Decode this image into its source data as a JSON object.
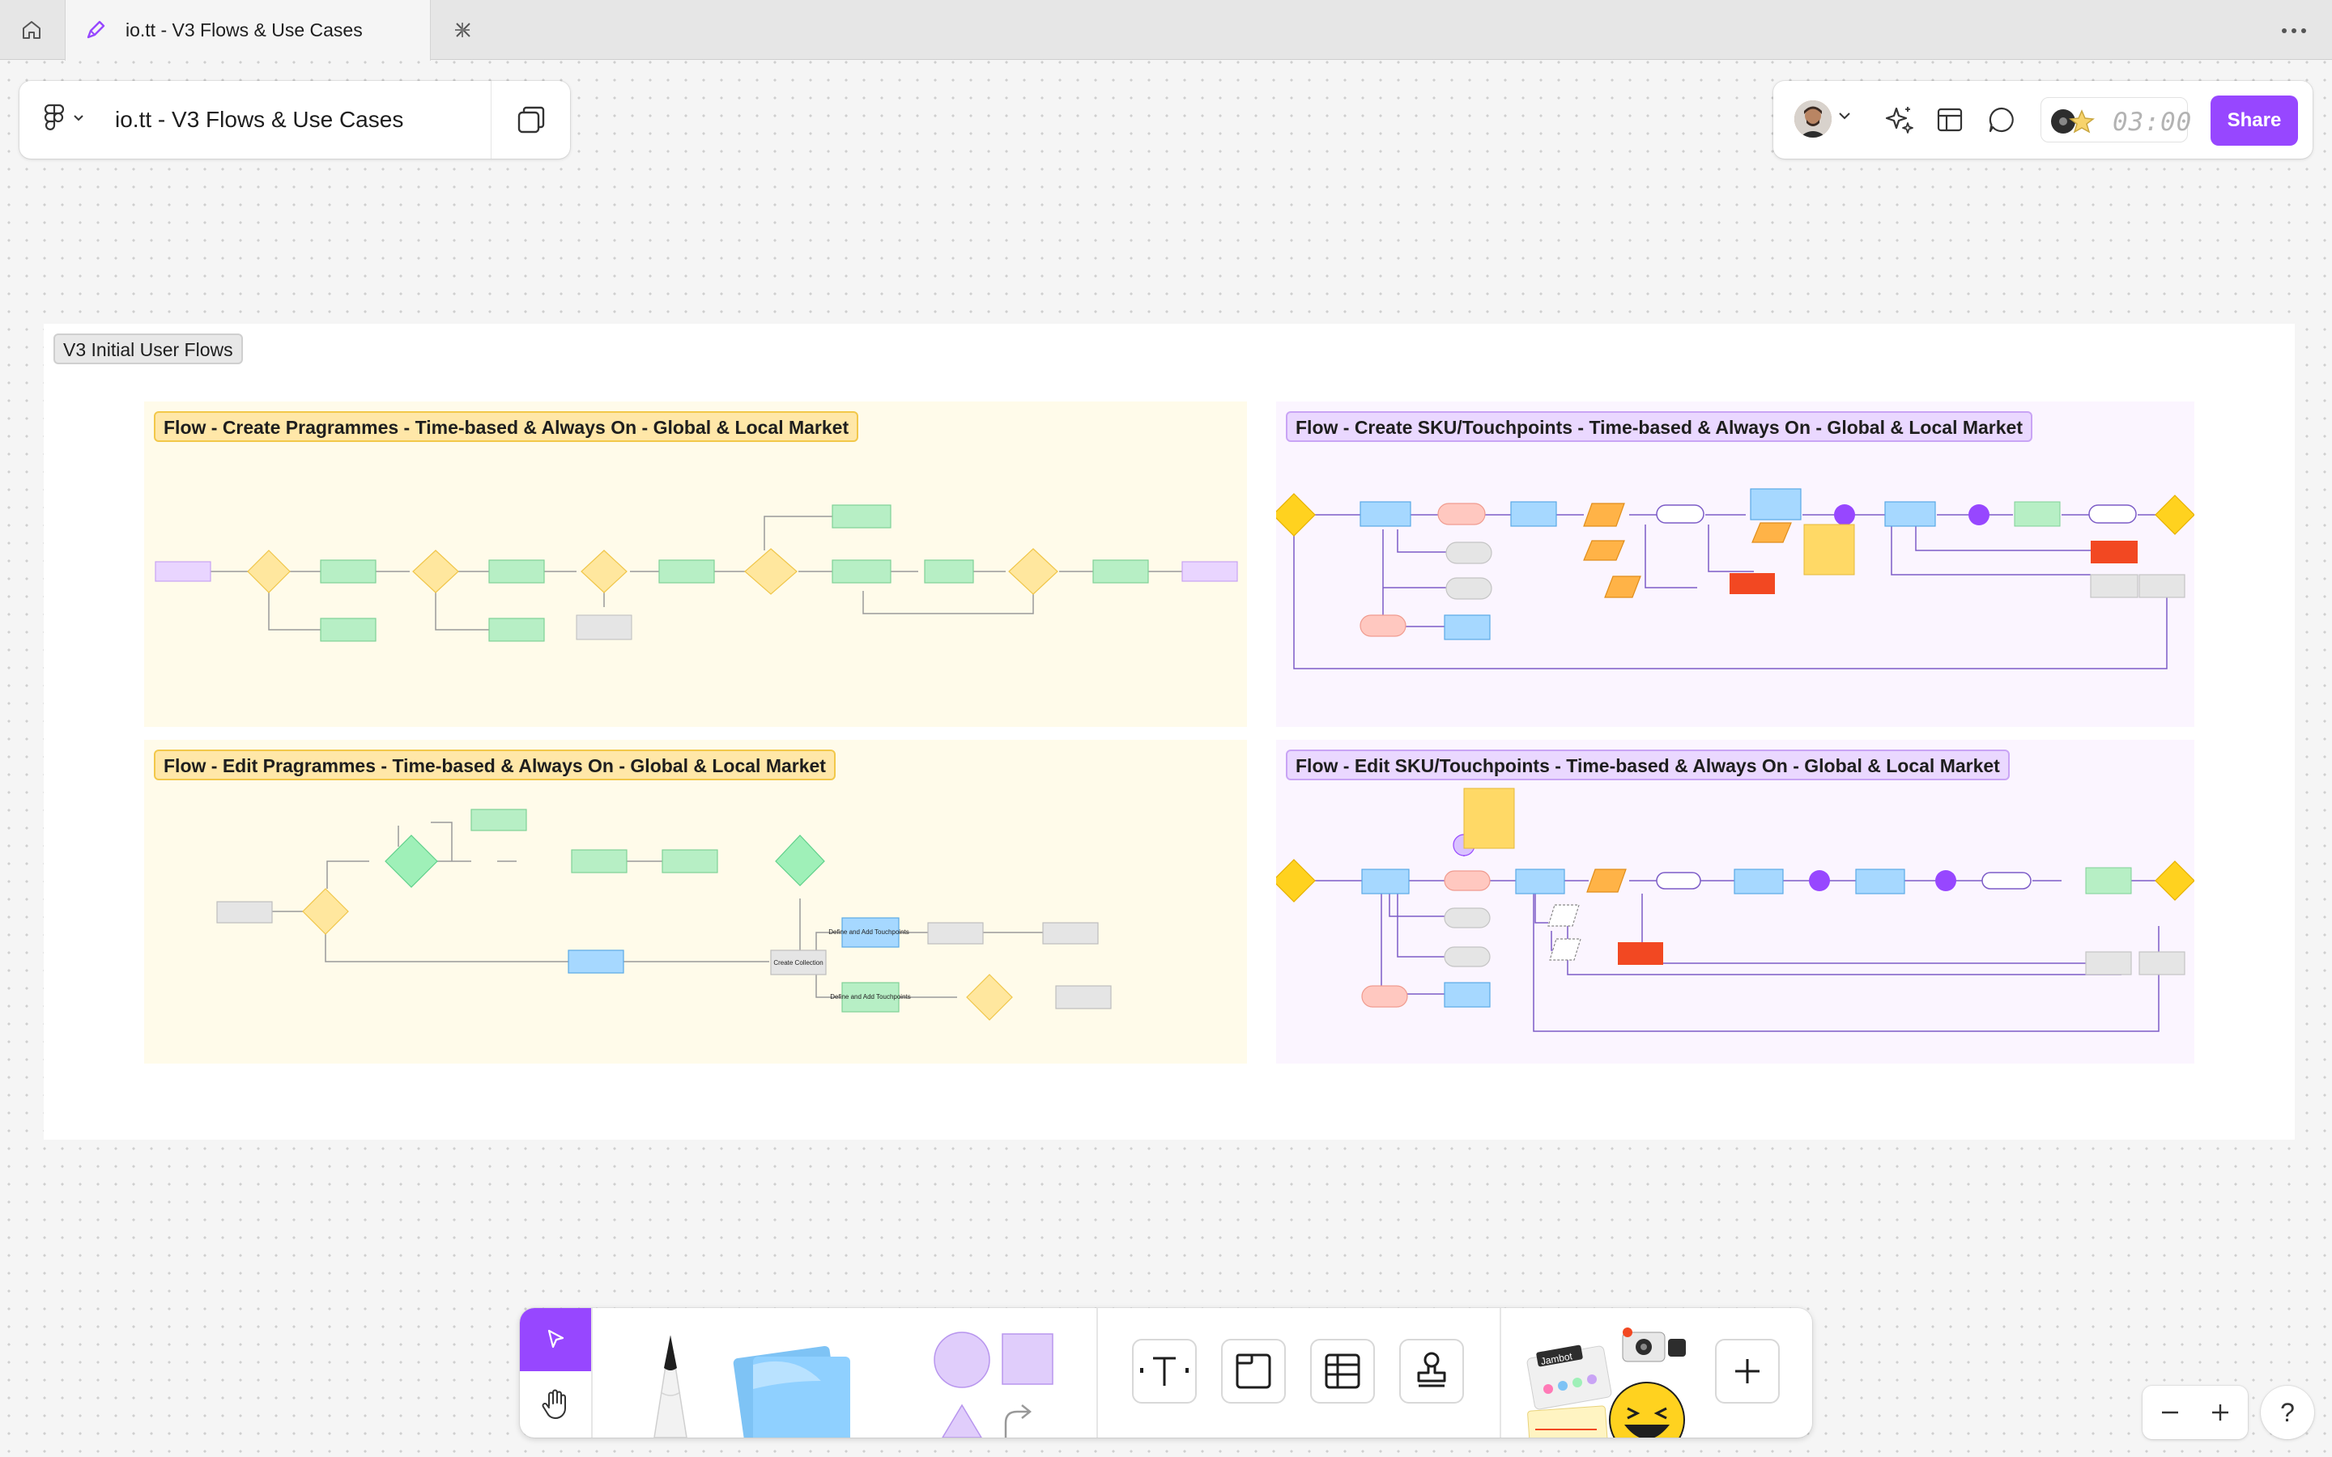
{
  "tabs": {
    "home_icon": "home-icon",
    "active_tab_title": "io.tt - V3 Flows & Use Cases",
    "tab_icon": "figjam-pen-icon",
    "add_icon": "plus-icon",
    "more_icon": "more-dots-icon"
  },
  "header": {
    "file_title": "io.tt - V3 Flows & Use Cases",
    "menu_icon": "figma-logo-icon",
    "pages_icon": "pages-copy-icon"
  },
  "toolbar_right": {
    "timer": "03:00",
    "share_label": "Share",
    "accent": "#9747ff"
  },
  "canvas": {
    "section_label": "V3 Initial User Flows",
    "panels": [
      {
        "id": "create-programmes",
        "title": "Flow - Create Pragrammes - Time-based & Always On - Global & Local Market",
        "color": "#ffe7a8"
      },
      {
        "id": "create-sku",
        "title": "Flow - Create SKU/Touchpoints - Time-based & Always On - Global & Local Market",
        "color": "#ead8ff"
      },
      {
        "id": "edit-programmes",
        "title": "Flow - Edit Pragrammes - Time-based & Always On - Global & Local Market",
        "color": "#ffe7a8"
      },
      {
        "id": "edit-sku",
        "title": "Flow - Edit SKU/Touchpoints - Time-based & Always On - Global & Local Market",
        "color": "#ead8ff"
      }
    ],
    "edit_programmes_nodes": {
      "create_collection": "Create Collection",
      "define_touchpoints_1": "Define and Add Touchpoints",
      "define_touchpoints_2": "Define and Add Touchpoints"
    }
  },
  "bottom_toolbar": {
    "tools": [
      "move-tool",
      "hand-tool",
      "pen-tool",
      "sticky-note-tool",
      "shapes-tool",
      "text-tool",
      "section-tool",
      "table-tool",
      "stamp-tool",
      "widgets",
      "add-tool"
    ],
    "widget_label": "Jambot"
  },
  "zoom": {
    "out": "−",
    "in": "+",
    "help": "?"
  }
}
